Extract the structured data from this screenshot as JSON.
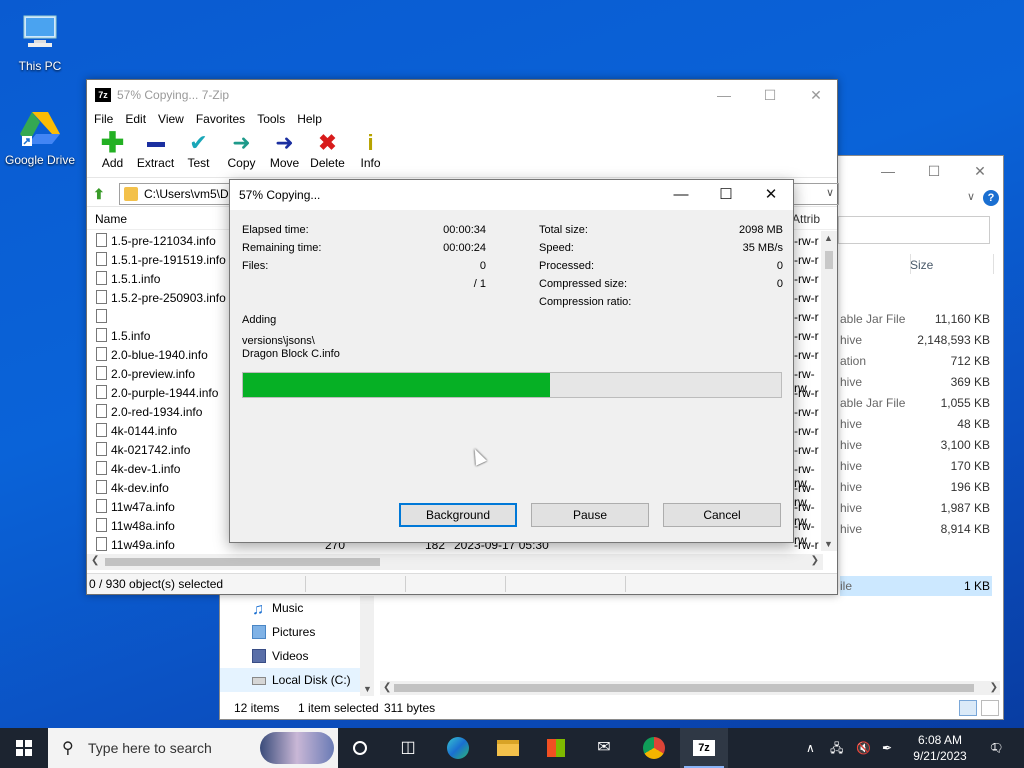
{
  "desktop": {
    "icons": [
      {
        "label": "This PC"
      },
      {
        "label": "Google Drive"
      }
    ]
  },
  "explorer": {
    "column_size": "Size",
    "rows": [
      {
        "type": "able Jar File",
        "size": "11,160 KB"
      },
      {
        "type": "hive",
        "size": "2,148,593 KB"
      },
      {
        "type": "ation",
        "size": "712 KB"
      },
      {
        "type": "hive",
        "size": "369 KB"
      },
      {
        "type": "able Jar File",
        "size": "1,055 KB"
      },
      {
        "type": "hive",
        "size": "48 KB"
      },
      {
        "type": "hive",
        "size": "3,100 KB"
      },
      {
        "type": "hive",
        "size": "170 KB"
      },
      {
        "type": "hive",
        "size": "196 KB"
      },
      {
        "type": "hive",
        "size": "1,987 KB"
      },
      {
        "type": "hive",
        "size": "8,914 KB"
      }
    ],
    "selected_row": {
      "type": "ile",
      "size": "1 KB"
    },
    "nav_items": [
      "Music",
      "Pictures",
      "Videos",
      "Local Disk (C:)"
    ],
    "status_items": "12 items",
    "status_selected": "1 item selected",
    "status_bytes": "311 bytes"
  },
  "zip": {
    "title": "57% Copying... 7-Zip",
    "logo": "7z",
    "menu": [
      "File",
      "Edit",
      "View",
      "Favorites",
      "Tools",
      "Help"
    ],
    "toolbar": [
      "Add",
      "Extract",
      "Test",
      "Copy",
      "Move",
      "Delete",
      "Info"
    ],
    "address": "C:\\Users\\vm5\\De",
    "column_name": "Name",
    "column_attrib": "Attrib",
    "files": [
      {
        "name": "1.5-pre-121034.info",
        "attr": "-rw-r"
      },
      {
        "name": "1.5.1-pre-191519.info",
        "attr": "-rw-r"
      },
      {
        "name": "1.5.1.info",
        "attr": "-rw-r"
      },
      {
        "name": "1.5.2-pre-250903.info",
        "attr": "-rw-r"
      },
      {
        "name": "",
        "attr": "-rw-r"
      },
      {
        "name": "1.5.info",
        "attr": "-rw-r"
      },
      {
        "name": "2.0-blue-1940.info",
        "attr": "-rw-r"
      },
      {
        "name": "2.0-preview.info",
        "attr": "-rw-rw"
      },
      {
        "name": "2.0-purple-1944.info",
        "attr": "-rw-r"
      },
      {
        "name": "2.0-red-1934.info",
        "attr": "-rw-r"
      },
      {
        "name": "4k-0144.info",
        "attr": "-rw-r"
      },
      {
        "name": "4k-021742.info",
        "attr": "-rw-r"
      },
      {
        "name": "4k-dev-1.info",
        "attr": "-rw-rw"
      },
      {
        "name": "4k-dev.info",
        "attr": "-rw-rw"
      },
      {
        "name": "11w47a.info",
        "attr": "-rw-rw"
      },
      {
        "name": "11w48a.info",
        "attr": "-rw-rw"
      },
      {
        "name": "11w49a.info",
        "attr": "-rw-r",
        "size": "270",
        "packed": "182",
        "modified": "2023-09-17 05:30"
      }
    ],
    "status": "0 / 930 object(s) selected"
  },
  "dialog": {
    "title": "57% Copying...",
    "elapsed_label": "Elapsed time:",
    "elapsed": "00:00:34",
    "remaining_label": "Remaining time:",
    "remaining": "00:00:24",
    "files_label": "Files:",
    "files": "0",
    "files_total": "/ 1",
    "total_size_label": "Total size:",
    "total_size": "2098 MB",
    "speed_label": "Speed:",
    "speed": "35 MB/s",
    "processed_label": "Processed:",
    "processed": "0",
    "compressed_label": "Compressed size:",
    "compressed": "0",
    "ratio_label": "Compression ratio:",
    "action": "Adding",
    "path_line1": "versions\\jsons\\",
    "path_line2": "Dragon Block C.info",
    "progress_percent": 57,
    "btn_background": "Background",
    "btn_pause": "Pause",
    "btn_cancel": "Cancel"
  },
  "taskbar": {
    "search_placeholder": "Type here to search",
    "time": "6:08 AM",
    "date": "9/21/2023",
    "notification_count": "1"
  }
}
